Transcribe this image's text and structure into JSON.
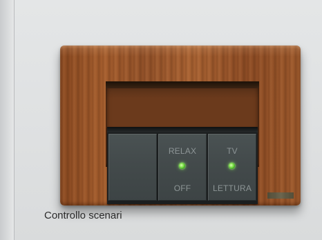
{
  "photo": {
    "keys": [
      {
        "top_label": "",
        "bottom_label": "",
        "led": false
      },
      {
        "top_label": "RELAX",
        "bottom_label": "OFF",
        "led": true,
        "led_color": "#7ee04a"
      },
      {
        "top_label": "TV",
        "bottom_label": "LETTURA",
        "led": true,
        "led_color": "#7ee04a"
      }
    ]
  },
  "caption": "Controllo scenari",
  "colors": {
    "wood": "#a55e2e",
    "key_face": "#434a4b",
    "key_label": "#8d9596",
    "background": "#dfe1e2"
  }
}
